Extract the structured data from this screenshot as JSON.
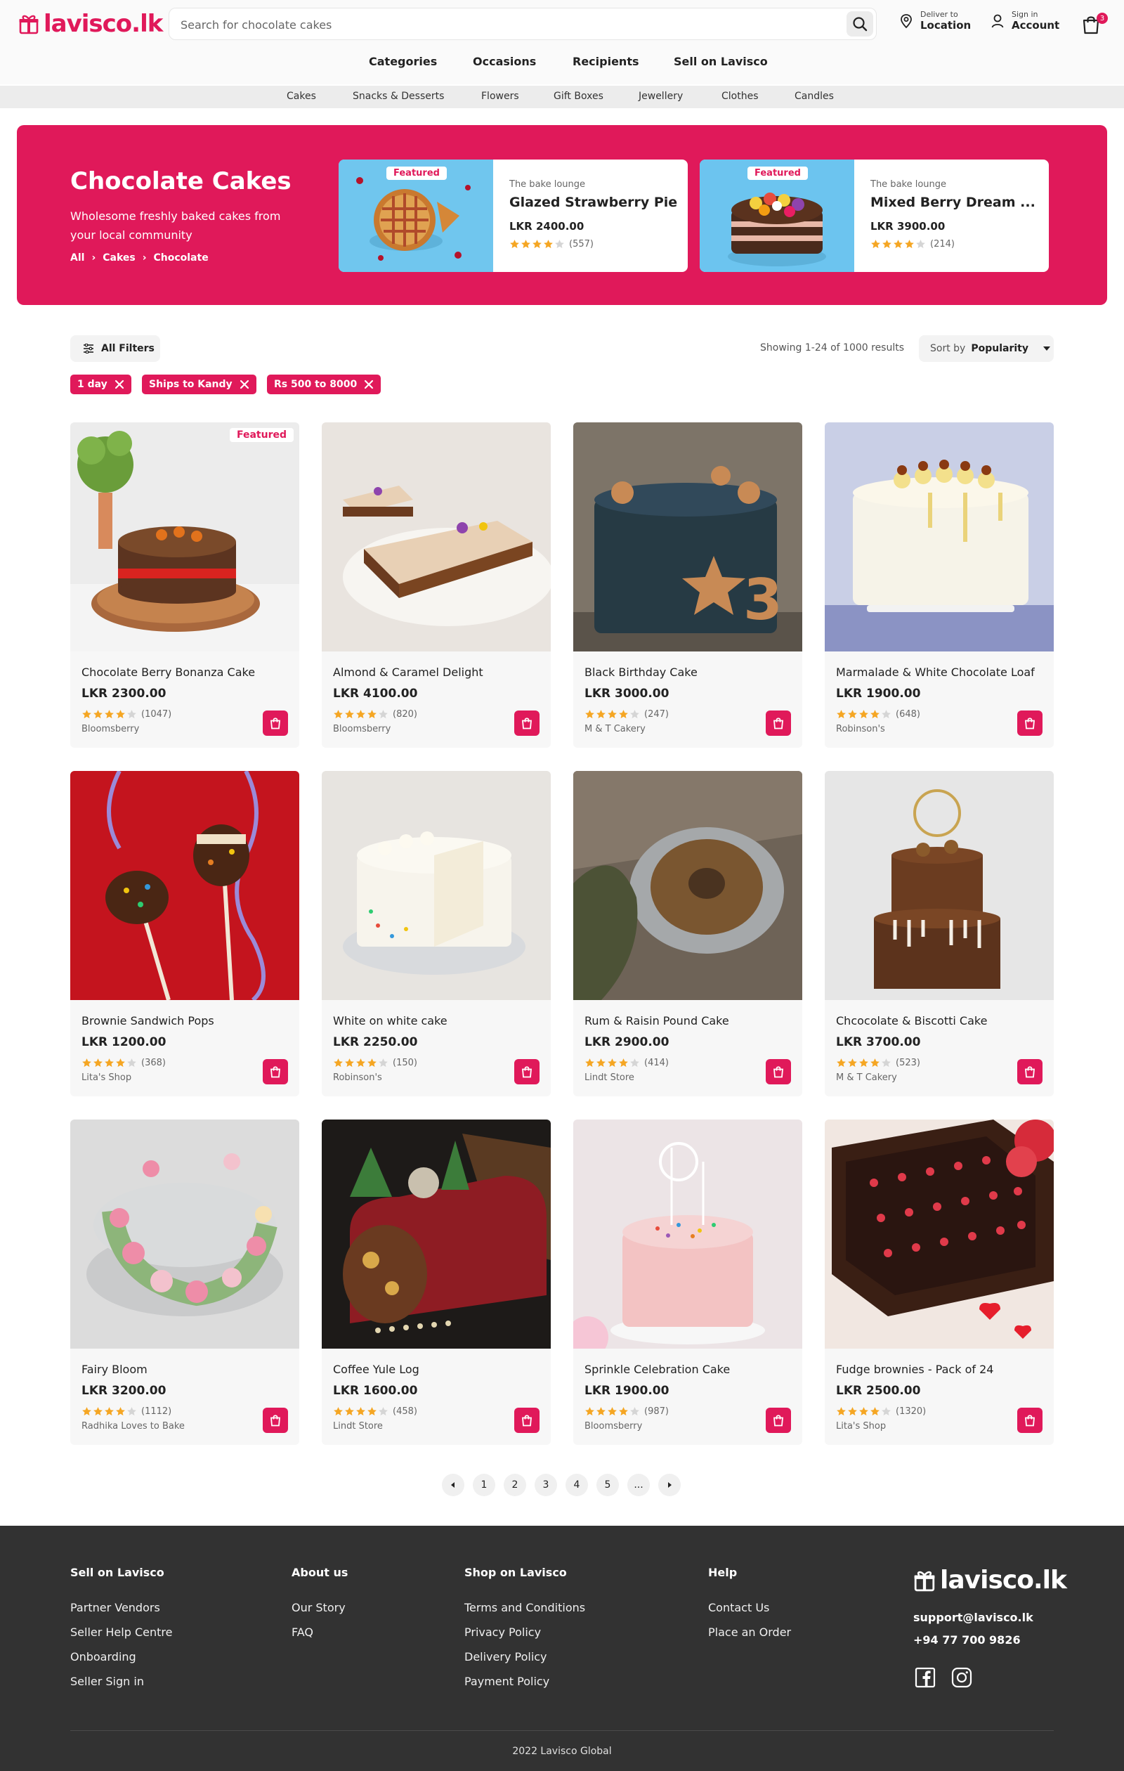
{
  "brand": {
    "name": "lavisco.lk",
    "accent": "#e0195a"
  },
  "search": {
    "placeholder": "Search for chocolate cakes"
  },
  "header": {
    "deliver_small": "Deliver to",
    "deliver_big": "Location",
    "signin_small": "Sign in",
    "signin_big": "Account",
    "cart_count": "3"
  },
  "main_nav": [
    "Categories",
    "Occasions",
    "Recipients",
    "Sell on Lavisco"
  ],
  "sub_nav": [
    "Cakes",
    "Snacks & Desserts",
    "Flowers",
    "Gift Boxes",
    "Jewellery",
    "Clothes",
    "Candles"
  ],
  "hero": {
    "title": "Chocolate Cakes",
    "subtitle": "Wholesome freshly baked cakes from your local community",
    "breadcrumbs": [
      "All",
      "Cakes",
      "Chocolate"
    ],
    "featured": [
      {
        "tag": "Featured",
        "vendor": "The bake lounge",
        "name": "Glazed Strawberry Pie",
        "price": "LKR 2400.00",
        "rating": 4,
        "reviews": "(557)"
      },
      {
        "tag": "Featured",
        "vendor": "The bake lounge",
        "name": "Mixed Berry Dream ...",
        "price": "LKR 3900.00",
        "rating": 4,
        "reviews": "(214)"
      }
    ]
  },
  "filters": {
    "all_filters": "All Filters",
    "showing": "Showing 1-24 of 1000 results",
    "sort_label": "Sort by",
    "sort_value": "Popularity",
    "chips": [
      "1 day",
      "Ships to Kandy",
      "Rs 500 to 8000"
    ]
  },
  "products": [
    {
      "name": "Chocolate Berry Bonanza Cake",
      "price": "LKR 2300.00",
      "rating": 4,
      "reviews": "(1047)",
      "vendor": "Bloomsberry",
      "tag": "Featured"
    },
    {
      "name": "Almond & Caramel Delight",
      "price": "LKR 4100.00",
      "rating": 4,
      "reviews": "(820)",
      "vendor": "Bloomsberry"
    },
    {
      "name": "Black Birthday Cake",
      "price": "LKR 3000.00",
      "rating": 4,
      "reviews": "(247)",
      "vendor": "M & T Cakery"
    },
    {
      "name": "Marmalade & White Chocolate Loaf",
      "price": "LKR 1900.00",
      "rating": 4,
      "reviews": "(648)",
      "vendor": "Robinson's"
    },
    {
      "name": "Brownie Sandwich Pops",
      "price": "LKR 1200.00",
      "rating": 4,
      "reviews": "(368)",
      "vendor": "Lita's Shop"
    },
    {
      "name": "White on white cake",
      "price": "LKR 2250.00",
      "rating": 4,
      "reviews": "(150)",
      "vendor": "Robinson's"
    },
    {
      "name": "Rum & Raisin Pound Cake",
      "price": "LKR 2900.00",
      "rating": 4,
      "reviews": "(414)",
      "vendor": "Lindt Store"
    },
    {
      "name": "Chcocolate & Biscotti Cake",
      "price": "LKR 3700.00",
      "rating": 4,
      "reviews": "(523)",
      "vendor": "M & T Cakery"
    },
    {
      "name": "Fairy Bloom",
      "price": "LKR 3200.00",
      "rating": 4,
      "reviews": "(1112)",
      "vendor": "Radhika Loves to Bake"
    },
    {
      "name": "Coffee Yule Log",
      "price": "LKR 1600.00",
      "rating": 4,
      "reviews": "(458)",
      "vendor": "Lindt Store"
    },
    {
      "name": "Sprinkle Celebration Cake",
      "price": "LKR 1900.00",
      "rating": 4,
      "reviews": "(987)",
      "vendor": "Bloomsberry"
    },
    {
      "name": "Fudge brownies - Pack of 24",
      "price": "LKR 2500.00",
      "rating": 4,
      "reviews": "(1320)",
      "vendor": "Lita's Shop"
    }
  ],
  "pagination": [
    "1",
    "2",
    "3",
    "4",
    "5",
    "..."
  ],
  "footer": {
    "col1": {
      "title": "Sell on Lavisco",
      "links": [
        "Partner Vendors",
        "Seller Help Centre",
        "Onboarding",
        "Seller Sign in"
      ]
    },
    "col2": {
      "title": "About us",
      "links": [
        "Our Story",
        "FAQ"
      ]
    },
    "col3": {
      "title": "Shop on Lavisco",
      "links": [
        "Terms and Conditions",
        "Privacy Policy",
        "Delivery Policy",
        "Payment Policy"
      ]
    },
    "col4": {
      "title": "Help",
      "links": [
        "Contact Us",
        "Place an Order"
      ]
    },
    "email": "support@lavisco.lk",
    "phone": "+94 77 700 9826",
    "copyright": "2022 Lavisco Global"
  }
}
